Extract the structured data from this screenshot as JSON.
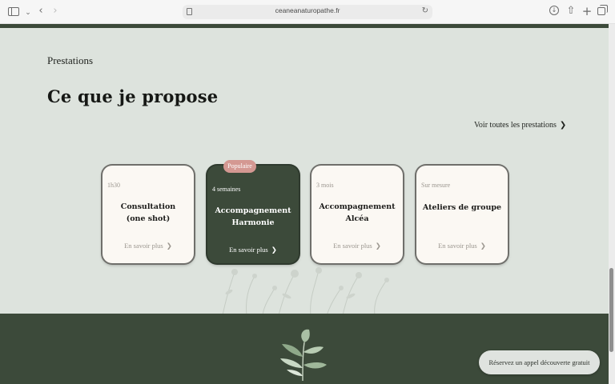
{
  "browser": {
    "url": "ceaneanaturopathe.fr"
  },
  "section": {
    "eyebrow": "Prestations",
    "title": "Ce que je propose",
    "see_all": "Voir toutes les prestations"
  },
  "cards": [
    {
      "meta": "1h30",
      "title": "Consultation\n(one shot)",
      "more": "En savoir plus",
      "badge": ""
    },
    {
      "meta": "4 semaines",
      "title": "Accompagnement\nHarmonie",
      "more": "En savoir plus",
      "badge": "Populaire"
    },
    {
      "meta": "3 mois",
      "title": "Accompagnement\nAlcéa",
      "more": "En savoir plus",
      "badge": ""
    },
    {
      "meta": "Sur mesure",
      "title": "Ateliers de groupe",
      "more": "En savoir plus",
      "badge": ""
    }
  ],
  "cta": {
    "label": "Réservez un appel découverte gratuit"
  },
  "colors": {
    "background": "#dde3dd",
    "forest": "#3c4a3a",
    "card": "#fbf8f3",
    "badge": "#d49892"
  },
  "icons": [
    "sidebar-icon",
    "chevron-down-icon",
    "back-icon",
    "forward-icon",
    "page-icon",
    "reload-icon",
    "download-icon",
    "share-icon",
    "new-tab-icon",
    "tabs-overview-icon",
    "chevron-right-icon",
    "leaf-logo-icon",
    "flowers-illustration"
  ]
}
